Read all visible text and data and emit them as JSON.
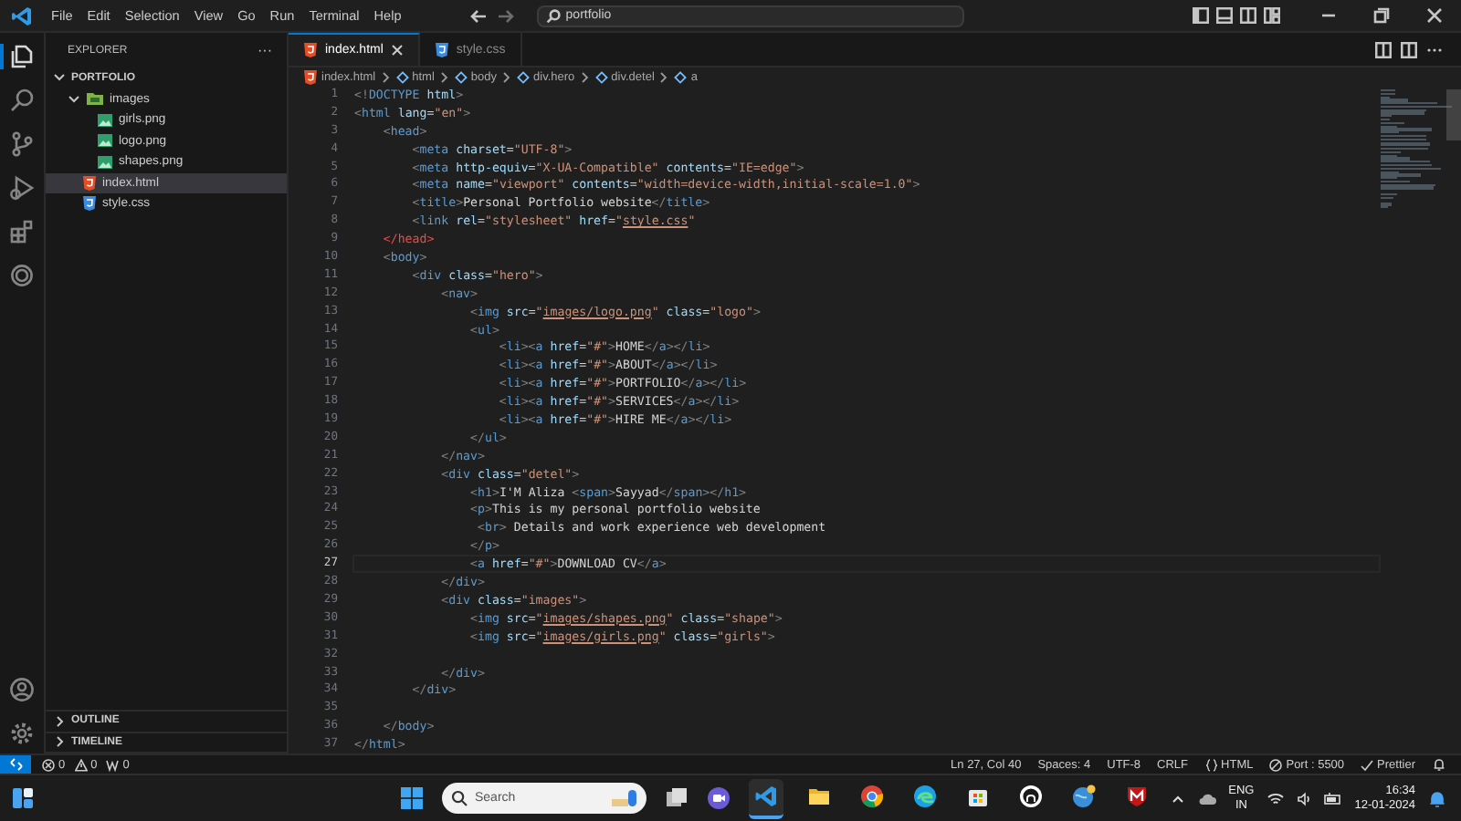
{
  "menu": [
    "File",
    "Edit",
    "Selection",
    "View",
    "Go",
    "Run",
    "Terminal",
    "Help"
  ],
  "command_center": {
    "text": "portfolio"
  },
  "sidebar": {
    "title": "EXPLORER",
    "more": "···",
    "tree": [
      {
        "label": "PORTFOLIO",
        "kind": "root",
        "expanded": true,
        "selected": false,
        "children": [
          {
            "label": "images",
            "kind": "folder",
            "expanded": true,
            "selected": false,
            "children": [
              {
                "label": "girls.png",
                "kind": "image",
                "selected": false
              },
              {
                "label": "logo.png",
                "kind": "image",
                "selected": false
              },
              {
                "label": "shapes.png",
                "kind": "image",
                "selected": false
              }
            ]
          },
          {
            "label": "index.html",
            "kind": "html",
            "selected": true
          },
          {
            "label": "style.css",
            "kind": "css",
            "selected": false
          }
        ]
      }
    ],
    "sections": [
      {
        "label": "OUTLINE",
        "expanded": false
      },
      {
        "label": "TIMELINE",
        "expanded": false
      }
    ]
  },
  "tabs": [
    {
      "label": "index.html",
      "kind": "html",
      "selected": true
    },
    {
      "label": "style.css",
      "kind": "css",
      "selected": false
    }
  ],
  "breadcrumbs": [
    {
      "kind": "file",
      "text": "index.html"
    },
    {
      "kind": "element",
      "text": "html"
    },
    {
      "kind": "element",
      "text": "body"
    },
    {
      "kind": "element",
      "text": "div.hero"
    },
    {
      "kind": "element",
      "text": "div.detel"
    },
    {
      "kind": "element",
      "text": "a"
    }
  ],
  "code": [
    {
      "num": "1",
      "current": false,
      "tokens": [
        {
          "kind": "p",
          "text": "<!"
        },
        {
          "kind": "tag",
          "text": "DOCTYPE"
        },
        {
          "kind": "attr",
          "text": " html"
        },
        {
          "kind": "p",
          "text": ">"
        }
      ]
    },
    {
      "num": "2",
      "current": false,
      "tokens": [
        {
          "kind": "p",
          "text": "<"
        },
        {
          "kind": "tag",
          "text": "html"
        },
        {
          "kind": "attr",
          "text": " lang"
        },
        {
          "kind": "txt",
          "text": "="
        },
        {
          "kind": "str",
          "text": "\"en\""
        },
        {
          "kind": "p",
          "text": ">"
        }
      ]
    },
    {
      "num": "3",
      "current": false,
      "tokens": [
        {
          "kind": "p",
          "text": "    <"
        },
        {
          "kind": "tag",
          "text": "head"
        },
        {
          "kind": "p",
          "text": ">"
        }
      ]
    },
    {
      "num": "4",
      "current": false,
      "tokens": [
        {
          "kind": "p",
          "text": "        <"
        },
        {
          "kind": "tag",
          "text": "meta"
        },
        {
          "kind": "attr",
          "text": " charset"
        },
        {
          "kind": "txt",
          "text": "="
        },
        {
          "kind": "str",
          "text": "\"UTF-8\""
        },
        {
          "kind": "p",
          "text": ">"
        }
      ]
    },
    {
      "num": "5",
      "current": false,
      "tokens": [
        {
          "kind": "p",
          "text": "        <"
        },
        {
          "kind": "tag",
          "text": "meta"
        },
        {
          "kind": "attr",
          "text": " http-equiv"
        },
        {
          "kind": "txt",
          "text": "="
        },
        {
          "kind": "str",
          "text": "\"X-UA-Compatible\""
        },
        {
          "kind": "attr",
          "text": " contents"
        },
        {
          "kind": "txt",
          "text": "="
        },
        {
          "kind": "str",
          "text": "\"IE=edge\""
        },
        {
          "kind": "p",
          "text": ">"
        }
      ]
    },
    {
      "num": "6",
      "current": false,
      "tokens": [
        {
          "kind": "p",
          "text": "        <"
        },
        {
          "kind": "tag",
          "text": "meta"
        },
        {
          "kind": "attr",
          "text": " name"
        },
        {
          "kind": "txt",
          "text": "="
        },
        {
          "kind": "str",
          "text": "\"viewport\""
        },
        {
          "kind": "attr",
          "text": " contents"
        },
        {
          "kind": "txt",
          "text": "="
        },
        {
          "kind": "str",
          "text": "\"width=device-width,initial-scale=1.0\""
        },
        {
          "kind": "p",
          "text": ">"
        }
      ]
    },
    {
      "num": "7",
      "current": false,
      "tokens": [
        {
          "kind": "p",
          "text": "        <"
        },
        {
          "kind": "tag",
          "text": "title"
        },
        {
          "kind": "p",
          "text": ">"
        },
        {
          "kind": "txt",
          "text": "Personal Portfolio website"
        },
        {
          "kind": "p",
          "text": "</"
        },
        {
          "kind": "tag",
          "text": "title"
        },
        {
          "kind": "p",
          "text": ">"
        }
      ]
    },
    {
      "num": "8",
      "current": false,
      "tokens": [
        {
          "kind": "p",
          "text": "        <"
        },
        {
          "kind": "tag",
          "text": "link"
        },
        {
          "kind": "attr",
          "text": " rel"
        },
        {
          "kind": "txt",
          "text": "="
        },
        {
          "kind": "str",
          "text": "\"stylesheet\""
        },
        {
          "kind": "attr",
          "text": " href"
        },
        {
          "kind": "txt",
          "text": "="
        },
        {
          "kind": "str",
          "text": "\""
        },
        {
          "kind": "link",
          "text": "style.css"
        },
        {
          "kind": "str",
          "text": "\""
        }
      ]
    },
    {
      "num": "9",
      "current": false,
      "tokens": [
        {
          "kind": "err",
          "text": "    </head>"
        }
      ]
    },
    {
      "num": "10",
      "current": false,
      "tokens": [
        {
          "kind": "p",
          "text": "    <"
        },
        {
          "kind": "tag",
          "text": "body"
        },
        {
          "kind": "p",
          "text": ">"
        }
      ]
    },
    {
      "num": "11",
      "current": false,
      "tokens": [
        {
          "kind": "p",
          "text": "        <"
        },
        {
          "kind": "tag",
          "text": "div"
        },
        {
          "kind": "attr",
          "text": " class"
        },
        {
          "kind": "txt",
          "text": "="
        },
        {
          "kind": "str",
          "text": "\"hero\""
        },
        {
          "kind": "p",
          "text": ">"
        }
      ]
    },
    {
      "num": "12",
      "current": false,
      "tokens": [
        {
          "kind": "p",
          "text": "            <"
        },
        {
          "kind": "tag",
          "text": "nav"
        },
        {
          "kind": "p",
          "text": ">"
        }
      ]
    },
    {
      "num": "13",
      "current": false,
      "tokens": [
        {
          "kind": "p",
          "text": "                <"
        },
        {
          "kind": "tag",
          "text": "img"
        },
        {
          "kind": "attr",
          "text": " src"
        },
        {
          "kind": "txt",
          "text": "="
        },
        {
          "kind": "str",
          "text": "\""
        },
        {
          "kind": "link",
          "text": "images/logo.png"
        },
        {
          "kind": "str",
          "text": "\""
        },
        {
          "kind": "attr",
          "text": " class"
        },
        {
          "kind": "txt",
          "text": "="
        },
        {
          "kind": "str",
          "text": "\"logo\""
        },
        {
          "kind": "p",
          "text": ">"
        }
      ]
    },
    {
      "num": "14",
      "current": false,
      "tokens": [
        {
          "kind": "p",
          "text": "                <"
        },
        {
          "kind": "tag",
          "text": "ul"
        },
        {
          "kind": "p",
          "text": ">"
        }
      ]
    },
    {
      "num": "15",
      "current": false,
      "tokens": [
        {
          "kind": "p",
          "text": "                    <"
        },
        {
          "kind": "tag",
          "text": "li"
        },
        {
          "kind": "p",
          "text": "><"
        },
        {
          "kind": "tag",
          "text": "a"
        },
        {
          "kind": "attr",
          "text": " href"
        },
        {
          "kind": "txt",
          "text": "="
        },
        {
          "kind": "str",
          "text": "\"#\""
        },
        {
          "kind": "p",
          "text": ">"
        },
        {
          "kind": "txt",
          "text": "HOME"
        },
        {
          "kind": "p",
          "text": "</"
        },
        {
          "kind": "tag",
          "text": "a"
        },
        {
          "kind": "p",
          "text": "></"
        },
        {
          "kind": "tag",
          "text": "li"
        },
        {
          "kind": "p",
          "text": ">"
        }
      ]
    },
    {
      "num": "16",
      "current": false,
      "tokens": [
        {
          "kind": "p",
          "text": "                    <"
        },
        {
          "kind": "tag",
          "text": "li"
        },
        {
          "kind": "p",
          "text": "><"
        },
        {
          "kind": "tag",
          "text": "a"
        },
        {
          "kind": "attr",
          "text": " href"
        },
        {
          "kind": "txt",
          "text": "="
        },
        {
          "kind": "str",
          "text": "\"#\""
        },
        {
          "kind": "p",
          "text": ">"
        },
        {
          "kind": "txt",
          "text": "ABOUT"
        },
        {
          "kind": "p",
          "text": "</"
        },
        {
          "kind": "tag",
          "text": "a"
        },
        {
          "kind": "p",
          "text": "></"
        },
        {
          "kind": "tag",
          "text": "li"
        },
        {
          "kind": "p",
          "text": ">"
        }
      ]
    },
    {
      "num": "17",
      "current": false,
      "tokens": [
        {
          "kind": "p",
          "text": "                    <"
        },
        {
          "kind": "tag",
          "text": "li"
        },
        {
          "kind": "p",
          "text": "><"
        },
        {
          "kind": "tag",
          "text": "a"
        },
        {
          "kind": "attr",
          "text": " href"
        },
        {
          "kind": "txt",
          "text": "="
        },
        {
          "kind": "str",
          "text": "\"#\""
        },
        {
          "kind": "p",
          "text": ">"
        },
        {
          "kind": "txt",
          "text": "PORTFOLIO"
        },
        {
          "kind": "p",
          "text": "</"
        },
        {
          "kind": "tag",
          "text": "a"
        },
        {
          "kind": "p",
          "text": "></"
        },
        {
          "kind": "tag",
          "text": "li"
        },
        {
          "kind": "p",
          "text": ">"
        }
      ]
    },
    {
      "num": "18",
      "current": false,
      "tokens": [
        {
          "kind": "p",
          "text": "                    <"
        },
        {
          "kind": "tag",
          "text": "li"
        },
        {
          "kind": "p",
          "text": "><"
        },
        {
          "kind": "tag",
          "text": "a"
        },
        {
          "kind": "attr",
          "text": " href"
        },
        {
          "kind": "txt",
          "text": "="
        },
        {
          "kind": "str",
          "text": "\"#\""
        },
        {
          "kind": "p",
          "text": ">"
        },
        {
          "kind": "txt",
          "text": "SERVICES"
        },
        {
          "kind": "p",
          "text": "</"
        },
        {
          "kind": "tag",
          "text": "a"
        },
        {
          "kind": "p",
          "text": "></"
        },
        {
          "kind": "tag",
          "text": "li"
        },
        {
          "kind": "p",
          "text": ">"
        }
      ]
    },
    {
      "num": "19",
      "current": false,
      "tokens": [
        {
          "kind": "p",
          "text": "                    <"
        },
        {
          "kind": "tag",
          "text": "li"
        },
        {
          "kind": "p",
          "text": "><"
        },
        {
          "kind": "tag",
          "text": "a"
        },
        {
          "kind": "attr",
          "text": " href"
        },
        {
          "kind": "txt",
          "text": "="
        },
        {
          "kind": "str",
          "text": "\"#\""
        },
        {
          "kind": "p",
          "text": ">"
        },
        {
          "kind": "txt",
          "text": "HIRE ME"
        },
        {
          "kind": "p",
          "text": "</"
        },
        {
          "kind": "tag",
          "text": "a"
        },
        {
          "kind": "p",
          "text": "></"
        },
        {
          "kind": "tag",
          "text": "li"
        },
        {
          "kind": "p",
          "text": ">"
        }
      ]
    },
    {
      "num": "20",
      "current": false,
      "tokens": [
        {
          "kind": "p",
          "text": "                </"
        },
        {
          "kind": "tag",
          "text": "ul"
        },
        {
          "kind": "p",
          "text": ">"
        }
      ]
    },
    {
      "num": "21",
      "current": false,
      "tokens": [
        {
          "kind": "p",
          "text": "            </"
        },
        {
          "kind": "tag",
          "text": "nav"
        },
        {
          "kind": "p",
          "text": ">"
        }
      ]
    },
    {
      "num": "22",
      "current": false,
      "tokens": [
        {
          "kind": "p",
          "text": "            <"
        },
        {
          "kind": "tag",
          "text": "div"
        },
        {
          "kind": "attr",
          "text": " class"
        },
        {
          "kind": "txt",
          "text": "="
        },
        {
          "kind": "str",
          "text": "\"detel\""
        },
        {
          "kind": "p",
          "text": ">"
        }
      ]
    },
    {
      "num": "23",
      "current": false,
      "tokens": [
        {
          "kind": "p",
          "text": "                <"
        },
        {
          "kind": "tag",
          "text": "h1"
        },
        {
          "kind": "p",
          "text": ">"
        },
        {
          "kind": "txt",
          "text": "I'M Aliza "
        },
        {
          "kind": "p",
          "text": "<"
        },
        {
          "kind": "tag",
          "text": "span"
        },
        {
          "kind": "p",
          "text": ">"
        },
        {
          "kind": "txt",
          "text": "Sayyad"
        },
        {
          "kind": "p",
          "text": "</"
        },
        {
          "kind": "tag",
          "text": "span"
        },
        {
          "kind": "p",
          "text": "></"
        },
        {
          "kind": "tag",
          "text": "h1"
        },
        {
          "kind": "p",
          "text": ">"
        }
      ]
    },
    {
      "num": "24",
      "current": false,
      "tokens": [
        {
          "kind": "p",
          "text": "                <"
        },
        {
          "kind": "tag",
          "text": "p"
        },
        {
          "kind": "p",
          "text": ">"
        },
        {
          "kind": "txt",
          "text": "This is my personal portfolio website"
        }
      ]
    },
    {
      "num": "25",
      "current": false,
      "tokens": [
        {
          "kind": "p",
          "text": "                 <"
        },
        {
          "kind": "tag",
          "text": "br"
        },
        {
          "kind": "p",
          "text": ">"
        },
        {
          "kind": "txt",
          "text": " Details and work experience web development"
        }
      ]
    },
    {
      "num": "26",
      "current": false,
      "tokens": [
        {
          "kind": "p",
          "text": "                </"
        },
        {
          "kind": "tag",
          "text": "p"
        },
        {
          "kind": "p",
          "text": ">"
        }
      ]
    },
    {
      "num": "27",
      "current": true,
      "tokens": [
        {
          "kind": "p",
          "text": "                <"
        },
        {
          "kind": "tag",
          "text": "a"
        },
        {
          "kind": "attr",
          "text": " href"
        },
        {
          "kind": "txt",
          "text": "="
        },
        {
          "kind": "str",
          "text": "\"#\""
        },
        {
          "kind": "p",
          "text": ">"
        },
        {
          "kind": "txt",
          "text": "DOWNLOAD CV"
        },
        {
          "kind": "p",
          "text": "</"
        },
        {
          "kind": "tag",
          "text": "a"
        },
        {
          "kind": "p",
          "text": ">"
        }
      ]
    },
    {
      "num": "28",
      "current": false,
      "tokens": [
        {
          "kind": "p",
          "text": "            </"
        },
        {
          "kind": "tag",
          "text": "div"
        },
        {
          "kind": "p",
          "text": ">"
        }
      ]
    },
    {
      "num": "29",
      "current": false,
      "tokens": [
        {
          "kind": "p",
          "text": "            <"
        },
        {
          "kind": "tag",
          "text": "div"
        },
        {
          "kind": "attr",
          "text": " class"
        },
        {
          "kind": "txt",
          "text": "="
        },
        {
          "kind": "str",
          "text": "\"images\""
        },
        {
          "kind": "p",
          "text": ">"
        }
      ]
    },
    {
      "num": "30",
      "current": false,
      "tokens": [
        {
          "kind": "p",
          "text": "                <"
        },
        {
          "kind": "tag",
          "text": "img"
        },
        {
          "kind": "attr",
          "text": " src"
        },
        {
          "kind": "txt",
          "text": "="
        },
        {
          "kind": "str",
          "text": "\""
        },
        {
          "kind": "link",
          "text": "images/shapes.png"
        },
        {
          "kind": "str",
          "text": "\""
        },
        {
          "kind": "attr",
          "text": " class"
        },
        {
          "kind": "txt",
          "text": "="
        },
        {
          "kind": "str",
          "text": "\"shape\""
        },
        {
          "kind": "p",
          "text": ">"
        }
      ]
    },
    {
      "num": "31",
      "current": false,
      "tokens": [
        {
          "kind": "p",
          "text": "                <"
        },
        {
          "kind": "tag",
          "text": "img"
        },
        {
          "kind": "attr",
          "text": " src"
        },
        {
          "kind": "txt",
          "text": "="
        },
        {
          "kind": "str",
          "text": "\""
        },
        {
          "kind": "link",
          "text": "images/girls.png"
        },
        {
          "kind": "str",
          "text": "\""
        },
        {
          "kind": "attr",
          "text": " class"
        },
        {
          "kind": "txt",
          "text": "="
        },
        {
          "kind": "str",
          "text": "\"girls\""
        },
        {
          "kind": "p",
          "text": ">"
        }
      ]
    },
    {
      "num": "32",
      "current": false
    },
    {
      "num": "33",
      "current": false,
      "tokens": [
        {
          "kind": "p",
          "text": "            </"
        },
        {
          "kind": "tag",
          "text": "div"
        },
        {
          "kind": "p",
          "text": ">"
        }
      ]
    },
    {
      "num": "34",
      "current": false,
      "tokens": [
        {
          "kind": "p",
          "text": "        </"
        },
        {
          "kind": "tag",
          "text": "div"
        },
        {
          "kind": "p",
          "text": ">"
        }
      ]
    },
    {
      "num": "35",
      "current": false
    },
    {
      "num": "36",
      "current": false,
      "tokens": [
        {
          "kind": "p",
          "text": "    </"
        },
        {
          "kind": "tag",
          "text": "body"
        },
        {
          "kind": "p",
          "text": ">"
        }
      ]
    },
    {
      "num": "37",
      "current": false,
      "tokens": [
        {
          "kind": "p",
          "text": "</"
        },
        {
          "kind": "tag",
          "text": "html"
        },
        {
          "kind": "p",
          "text": ">"
        }
      ]
    }
  ],
  "status_bar": {
    "left": [
      {
        "kind": "errors",
        "text": "0"
      },
      {
        "kind": "warnings",
        "text": "0"
      },
      {
        "kind": "ports",
        "text": "0"
      }
    ],
    "right": [
      {
        "kind": "plain",
        "text": "Ln 27, Col 40"
      },
      {
        "kind": "plain",
        "text": "Spaces: 4"
      },
      {
        "kind": "plain",
        "text": "UTF-8"
      },
      {
        "kind": "plain",
        "text": "CRLF"
      },
      {
        "kind": "language",
        "text": "HTML"
      },
      {
        "kind": "live",
        "text": "Port : 5500"
      },
      {
        "kind": "check",
        "text": "Prettier"
      }
    ]
  },
  "taskbar": {
    "search": {
      "placeholder": "Search"
    },
    "apps": [
      {
        "kind": "code",
        "selected": true
      },
      {
        "kind": "folder",
        "selected": false
      },
      {
        "kind": "chrome",
        "selected": false
      },
      {
        "kind": "edge",
        "selected": false
      },
      {
        "kind": "store",
        "selected": false
      },
      {
        "kind": "github",
        "selected": false
      },
      {
        "kind": "globe",
        "selected": false
      },
      {
        "kind": "shield",
        "selected": false
      }
    ],
    "language": [
      "ENG",
      "IN"
    ],
    "time": "16:34",
    "date": "12-01-2024"
  }
}
